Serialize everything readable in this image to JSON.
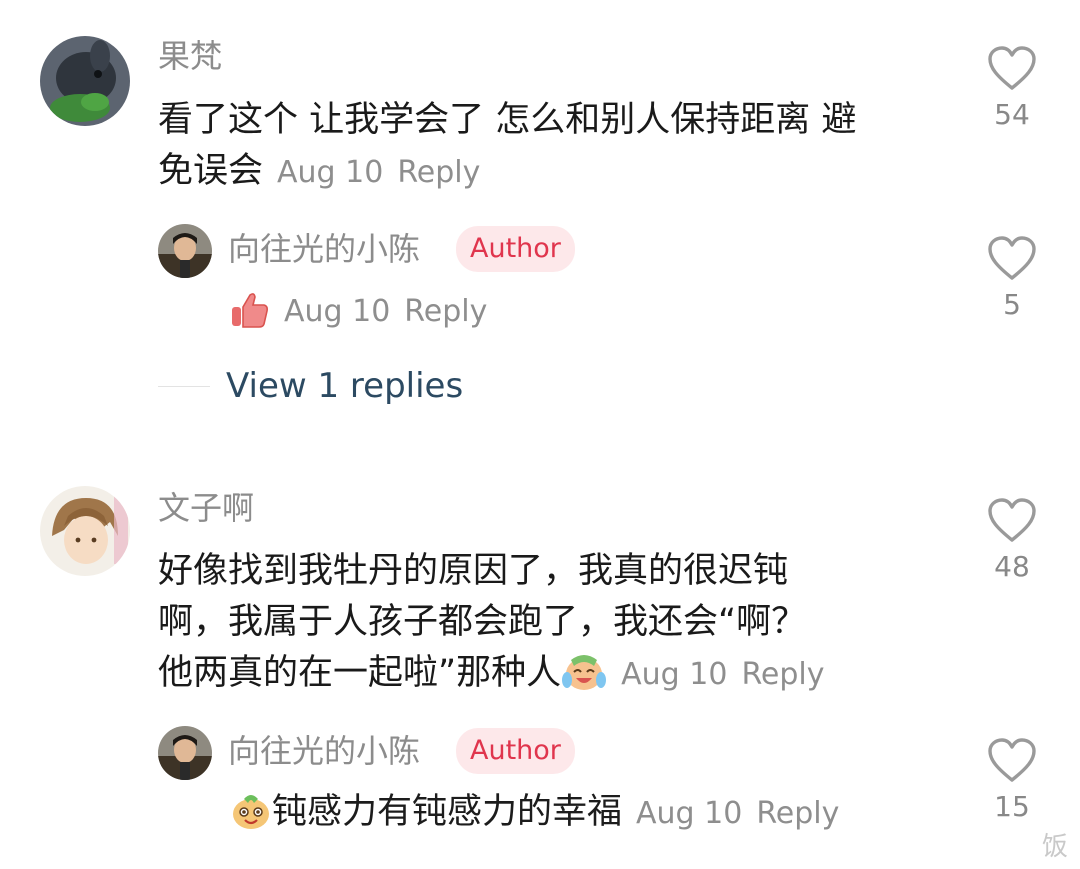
{
  "comments": [
    {
      "username": "果梵",
      "text_line1": "看了这个 让我学会了 怎么和别人保持距离 避",
      "text_line2": "免误会",
      "date": "Aug 10",
      "reply_label": "Reply",
      "likes": "54",
      "avatar_icon": "rabbit-avatar-icon",
      "reply": {
        "username": "向往光的小陈",
        "badge": "Author",
        "emoji_icon": "thumbs-up-emoji-icon",
        "date": "Aug 10",
        "reply_label": "Reply",
        "likes": "5"
      },
      "view_replies": "View 1 replies"
    },
    {
      "username": "文子啊",
      "text_line1": "好像找到我牡丹的原因了，我真的很迟钝",
      "text_line2": "啊，我属于人孩子都会跑了，我还会“啊？",
      "text_line3": "他两真的在一起啦”那种人",
      "emoji_icon": "laugh-cry-emoji-icon",
      "date": "Aug 10",
      "reply_label": "Reply",
      "likes": "48",
      "avatar_icon": "anime-avatar-icon",
      "reply": {
        "username": "向往光的小陈",
        "badge": "Author",
        "emoji_icon": "happy-face-emoji-icon",
        "text": "钝感力有钝感力的幸福",
        "date": "Aug 10",
        "reply_label": "Reply",
        "likes": "15"
      }
    }
  ],
  "colors": {
    "badge_bg": "#fde8ea",
    "badge_text": "#e0354d",
    "meta_gray": "#8e8e8e",
    "link_blue": "#2c4a62"
  },
  "watermark": "饭"
}
